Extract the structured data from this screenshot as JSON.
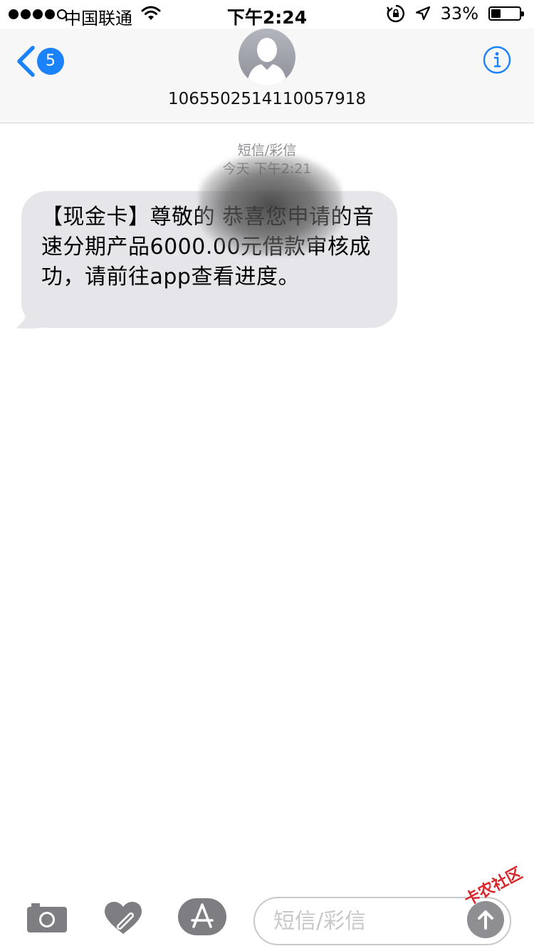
{
  "status_bar": {
    "carrier": "中国联通",
    "time": "下午2:24",
    "battery_text": "33%",
    "battery_level": 0.33,
    "signal_bars_filled": 4,
    "signal_bars_total": 5
  },
  "nav": {
    "back_count": "5",
    "contact_number": "1065502514110057918"
  },
  "thread": {
    "service_label": "短信/彩信",
    "timestamp": "今天 下午2:21",
    "messages": [
      {
        "direction": "incoming",
        "text": "【现金卡】尊敬的            恭喜您申请的音速分期产品6000.00元借款审核成功，请前往app查看进度。"
      }
    ]
  },
  "input_bar": {
    "placeholder": "短信/彩信"
  },
  "watermark": "卡农社区",
  "colors": {
    "accent": "#1a82fb",
    "bubble_incoming": "#e5e5ea",
    "meta_gray": "#8e8e93",
    "icon_gray": "#7d7d82"
  }
}
